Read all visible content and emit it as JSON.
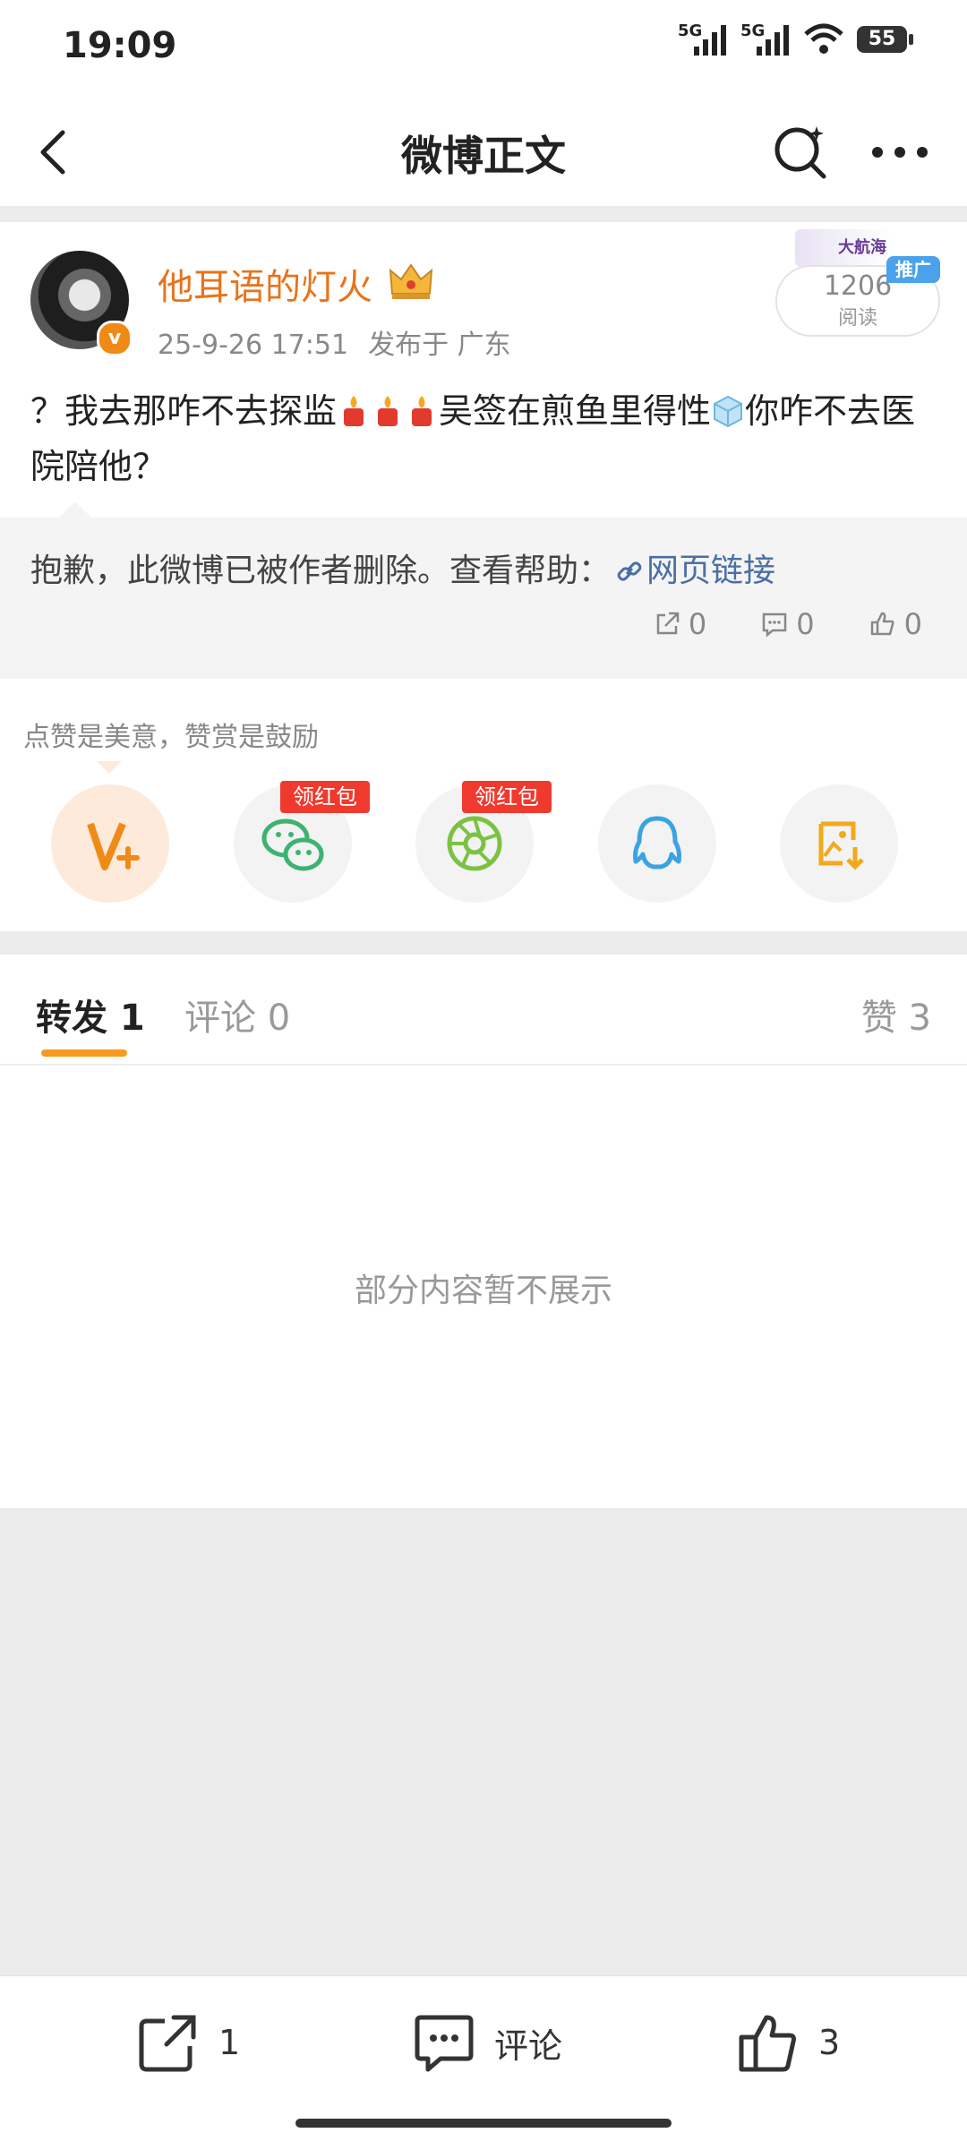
{
  "status_bar": {
    "time": "19:09",
    "network_1": "5G",
    "network_2": "5G",
    "battery": "55"
  },
  "nav": {
    "title": "微博正文"
  },
  "post": {
    "username": "他耳语的灯火",
    "time": "25-9-26 17:51",
    "location": "发布于 广东",
    "promo": {
      "read_count": "1206",
      "read_label": "阅读",
      "tag": "推广",
      "banner": "大航海"
    },
    "text_part1": "？我去那咋不去探监",
    "text_part2": "吴签在煎鱼里得性",
    "text_part3": "你咋不去医院陪他？"
  },
  "quote": {
    "deleted_text": "抱歉，此微博已被作者删除。查看帮助：",
    "link_text": "网页链接",
    "repost_count": "0",
    "comment_count": "0",
    "like_count": "0"
  },
  "share": {
    "hint": "点赞是美意，赞赏是鼓励",
    "redbag_label_1": "领红包",
    "redbag_label_2": "领红包",
    "icons": [
      "reward-v-icon",
      "wechat-icon",
      "moments-icon",
      "qq-icon",
      "save-image-icon"
    ]
  },
  "tabs": {
    "repost": "转发 1",
    "comment": "评论 0",
    "like": "赞 3"
  },
  "list": {
    "message": "部分内容暂不展示"
  },
  "bottom": {
    "repost_count": "1",
    "comment_label": "评论",
    "like_count": "3"
  },
  "colors": {
    "accent": "#f79a1d",
    "username": "#e8731a",
    "link": "#4a6fa5",
    "redbag": "#f03a2e"
  }
}
